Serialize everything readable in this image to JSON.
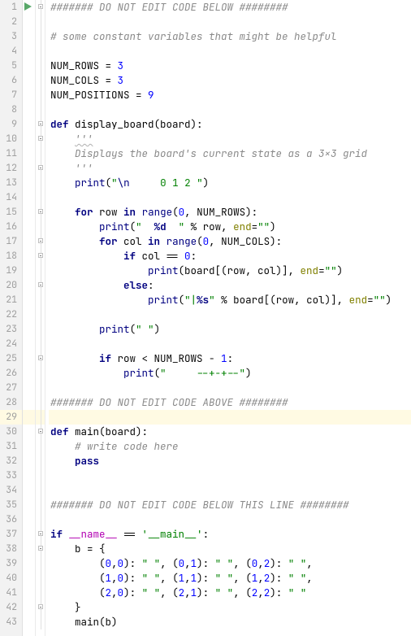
{
  "highlight_line": 29,
  "run_marker_line": 1,
  "lines": [
    {
      "n": 1,
      "fold": "start",
      "tokens": [
        {
          "t": "####### DO NOT EDIT CODE BELOW ########",
          "c": "c-comment"
        }
      ]
    },
    {
      "n": 2,
      "tokens": []
    },
    {
      "n": 3,
      "tokens": [
        {
          "t": "# some constant variables that might be helpful",
          "c": "c-comment"
        }
      ]
    },
    {
      "n": 4,
      "tokens": []
    },
    {
      "n": 5,
      "tokens": [
        {
          "t": "NUM_ROWS "
        },
        {
          "t": "=",
          "c": "c-op"
        },
        {
          "t": " "
        },
        {
          "t": "3",
          "c": "c-number"
        }
      ]
    },
    {
      "n": 6,
      "tokens": [
        {
          "t": "NUM_COLS "
        },
        {
          "t": "=",
          "c": "c-op"
        },
        {
          "t": " "
        },
        {
          "t": "3",
          "c": "c-number"
        }
      ]
    },
    {
      "n": 7,
      "tokens": [
        {
          "t": "NUM_POSITIONS "
        },
        {
          "t": "=",
          "c": "c-op"
        },
        {
          "t": " "
        },
        {
          "t": "9",
          "c": "c-number"
        }
      ]
    },
    {
      "n": 8,
      "tokens": []
    },
    {
      "n": 9,
      "fold": "start",
      "tokens": [
        {
          "t": "def ",
          "c": "c-def"
        },
        {
          "t": "display_board",
          "c": "c-funcname"
        },
        {
          "t": "(board):"
        }
      ]
    },
    {
      "n": 10,
      "fold": "start",
      "tokens": [
        {
          "t": "    "
        },
        {
          "t": "'''",
          "c": "c-docstr c-wavy"
        }
      ]
    },
    {
      "n": 11,
      "tokens": [
        {
          "t": "    "
        },
        {
          "t": "Displays the board's current state as a 3x3 grid",
          "c": "c-docstr"
        }
      ]
    },
    {
      "n": 12,
      "fold": "end",
      "tokens": [
        {
          "t": "    "
        },
        {
          "t": "'''",
          "c": "c-docstr"
        }
      ]
    },
    {
      "n": 13,
      "tokens": [
        {
          "t": "    "
        },
        {
          "t": "print",
          "c": "c-builtin"
        },
        {
          "t": "("
        },
        {
          "t": "\"",
          "c": "c-string"
        },
        {
          "t": "\\n",
          "c": "c-escape"
        },
        {
          "t": "     0 1 2 \"",
          "c": "c-string"
        },
        {
          "t": ")"
        }
      ]
    },
    {
      "n": 14,
      "tokens": []
    },
    {
      "n": 15,
      "fold": "start",
      "tokens": [
        {
          "t": "    "
        },
        {
          "t": "for ",
          "c": "c-keyword"
        },
        {
          "t": "row "
        },
        {
          "t": "in ",
          "c": "c-keyword"
        },
        {
          "t": "range",
          "c": "c-builtin"
        },
        {
          "t": "("
        },
        {
          "t": "0",
          "c": "c-number"
        },
        {
          "t": ", NUM_ROWS):"
        }
      ]
    },
    {
      "n": 16,
      "tokens": [
        {
          "t": "        "
        },
        {
          "t": "print",
          "c": "c-builtin"
        },
        {
          "t": "("
        },
        {
          "t": "\"  ",
          "c": "c-string"
        },
        {
          "t": "%d",
          "c": "c-fmt"
        },
        {
          "t": "  \"",
          "c": "c-string"
        },
        {
          "t": " % row, "
        },
        {
          "t": "end",
          "c": "c-selfish"
        },
        {
          "t": "="
        },
        {
          "t": "\"\"",
          "c": "c-string"
        },
        {
          "t": ")"
        }
      ]
    },
    {
      "n": 17,
      "fold": "start",
      "tokens": [
        {
          "t": "        "
        },
        {
          "t": "for ",
          "c": "c-keyword"
        },
        {
          "t": "col "
        },
        {
          "t": "in ",
          "c": "c-keyword"
        },
        {
          "t": "range",
          "c": "c-builtin"
        },
        {
          "t": "("
        },
        {
          "t": "0",
          "c": "c-number"
        },
        {
          "t": ", NUM_COLS):"
        }
      ]
    },
    {
      "n": 18,
      "fold": "start",
      "tokens": [
        {
          "t": "            "
        },
        {
          "t": "if ",
          "c": "c-keyword"
        },
        {
          "t": "col == "
        },
        {
          "t": "0",
          "c": "c-number"
        },
        {
          "t": ":"
        }
      ]
    },
    {
      "n": 19,
      "tokens": [
        {
          "t": "                "
        },
        {
          "t": "print",
          "c": "c-builtin"
        },
        {
          "t": "(board[(row, col)], "
        },
        {
          "t": "end",
          "c": "c-selfish"
        },
        {
          "t": "="
        },
        {
          "t": "\"\"",
          "c": "c-string"
        },
        {
          "t": ")"
        }
      ]
    },
    {
      "n": 20,
      "fold": "start",
      "tokens": [
        {
          "t": "            "
        },
        {
          "t": "else",
          "c": "c-keyword"
        },
        {
          "t": ":"
        }
      ]
    },
    {
      "n": 21,
      "tokens": [
        {
          "t": "                "
        },
        {
          "t": "print",
          "c": "c-builtin"
        },
        {
          "t": "("
        },
        {
          "t": "\"|",
          "c": "c-string"
        },
        {
          "t": "%s",
          "c": "c-fmt"
        },
        {
          "t": "\"",
          "c": "c-string"
        },
        {
          "t": " % board[(row, col)], "
        },
        {
          "t": "end",
          "c": "c-selfish"
        },
        {
          "t": "="
        },
        {
          "t": "\"\"",
          "c": "c-string"
        },
        {
          "t": ")"
        }
      ]
    },
    {
      "n": 22,
      "tokens": []
    },
    {
      "n": 23,
      "tokens": [
        {
          "t": "        "
        },
        {
          "t": "print",
          "c": "c-builtin"
        },
        {
          "t": "("
        },
        {
          "t": "\" \"",
          "c": "c-string"
        },
        {
          "t": ")"
        }
      ]
    },
    {
      "n": 24,
      "tokens": []
    },
    {
      "n": 25,
      "fold": "start",
      "tokens": [
        {
          "t": "        "
        },
        {
          "t": "if ",
          "c": "c-keyword"
        },
        {
          "t": "row < NUM_ROWS - "
        },
        {
          "t": "1",
          "c": "c-number"
        },
        {
          "t": ":"
        }
      ]
    },
    {
      "n": 26,
      "tokens": [
        {
          "t": "            "
        },
        {
          "t": "print",
          "c": "c-builtin"
        },
        {
          "t": "("
        },
        {
          "t": "\"     --+-+--\"",
          "c": "c-string"
        },
        {
          "t": ")"
        }
      ]
    },
    {
      "n": 27,
      "tokens": []
    },
    {
      "n": 28,
      "tokens": [
        {
          "t": "####### DO NOT EDIT CODE ABOVE ########",
          "c": "c-comment"
        }
      ]
    },
    {
      "n": 29,
      "tokens": []
    },
    {
      "n": 30,
      "fold": "start",
      "tokens": [
        {
          "t": "def ",
          "c": "c-def"
        },
        {
          "t": "main",
          "c": "c-funcname"
        },
        {
          "t": "(board):"
        }
      ]
    },
    {
      "n": 31,
      "tokens": [
        {
          "t": "    "
        },
        {
          "t": "# write code here",
          "c": "c-comment"
        }
      ]
    },
    {
      "n": 32,
      "tokens": [
        {
          "t": "    "
        },
        {
          "t": "pass",
          "c": "c-keyword"
        }
      ]
    },
    {
      "n": 33,
      "tokens": []
    },
    {
      "n": 34,
      "tokens": []
    },
    {
      "n": 35,
      "tokens": [
        {
          "t": "####### DO NOT EDIT CODE BELOW THIS LINE ########",
          "c": "c-comment"
        }
      ]
    },
    {
      "n": 36,
      "tokens": []
    },
    {
      "n": 37,
      "fold": "start",
      "tokens": [
        {
          "t": "if ",
          "c": "c-keyword"
        },
        {
          "t": "__name__",
          "c": "c-magic"
        },
        {
          "t": " == "
        },
        {
          "t": "'__main__'",
          "c": "c-string"
        },
        {
          "t": ":"
        }
      ]
    },
    {
      "n": 38,
      "fold": "start",
      "tokens": [
        {
          "t": "    b = {"
        }
      ]
    },
    {
      "n": 39,
      "tokens": [
        {
          "t": "        ("
        },
        {
          "t": "0",
          "c": "c-number"
        },
        {
          "t": ","
        },
        {
          "t": "0",
          "c": "c-number"
        },
        {
          "t": "): "
        },
        {
          "t": "\" \"",
          "c": "c-string"
        },
        {
          "t": ", ("
        },
        {
          "t": "0",
          "c": "c-number"
        },
        {
          "t": ","
        },
        {
          "t": "1",
          "c": "c-number"
        },
        {
          "t": "): "
        },
        {
          "t": "\" \"",
          "c": "c-string"
        },
        {
          "t": ", ("
        },
        {
          "t": "0",
          "c": "c-number"
        },
        {
          "t": ","
        },
        {
          "t": "2",
          "c": "c-number"
        },
        {
          "t": "): "
        },
        {
          "t": "\" \"",
          "c": "c-string"
        },
        {
          "t": ","
        }
      ]
    },
    {
      "n": 40,
      "tokens": [
        {
          "t": "        ("
        },
        {
          "t": "1",
          "c": "c-number"
        },
        {
          "t": ","
        },
        {
          "t": "0",
          "c": "c-number"
        },
        {
          "t": "): "
        },
        {
          "t": "\" \"",
          "c": "c-string"
        },
        {
          "t": ", ("
        },
        {
          "t": "1",
          "c": "c-number"
        },
        {
          "t": ","
        },
        {
          "t": "1",
          "c": "c-number"
        },
        {
          "t": "): "
        },
        {
          "t": "\" \"",
          "c": "c-string"
        },
        {
          "t": ", ("
        },
        {
          "t": "1",
          "c": "c-number"
        },
        {
          "t": ","
        },
        {
          "t": "2",
          "c": "c-number"
        },
        {
          "t": "): "
        },
        {
          "t": "\" \"",
          "c": "c-string"
        },
        {
          "t": ","
        }
      ]
    },
    {
      "n": 41,
      "tokens": [
        {
          "t": "        ("
        },
        {
          "t": "2",
          "c": "c-number"
        },
        {
          "t": ","
        },
        {
          "t": "0",
          "c": "c-number"
        },
        {
          "t": "): "
        },
        {
          "t": "\" \"",
          "c": "c-string"
        },
        {
          "t": ", ("
        },
        {
          "t": "2",
          "c": "c-number"
        },
        {
          "t": ","
        },
        {
          "t": "1",
          "c": "c-number"
        },
        {
          "t": "): "
        },
        {
          "t": "\" \"",
          "c": "c-string"
        },
        {
          "t": ", ("
        },
        {
          "t": "2",
          "c": "c-number"
        },
        {
          "t": ","
        },
        {
          "t": "2",
          "c": "c-number"
        },
        {
          "t": "): "
        },
        {
          "t": "\" \"",
          "c": "c-string"
        }
      ]
    },
    {
      "n": 42,
      "fold": "end",
      "tokens": [
        {
          "t": "    }"
        }
      ]
    },
    {
      "n": 43,
      "tokens": [
        {
          "t": "    main(b)"
        }
      ]
    }
  ]
}
